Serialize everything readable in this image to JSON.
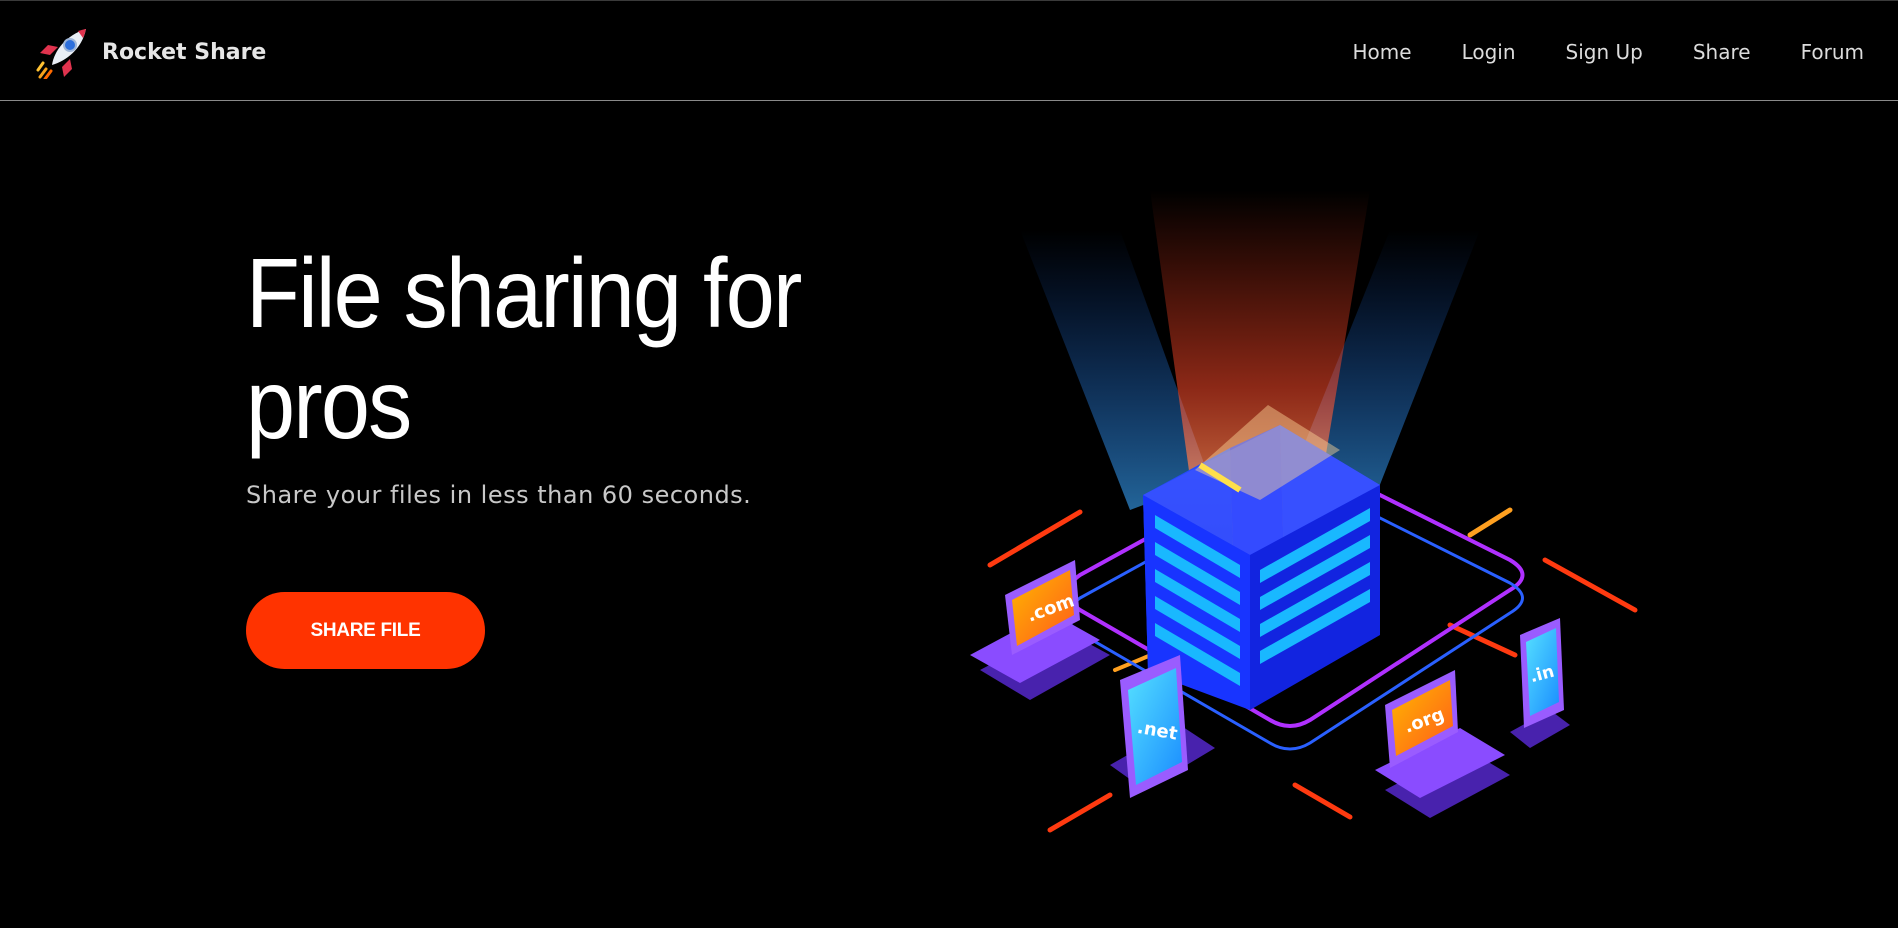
{
  "nav": {
    "brand": "Rocket Share",
    "links": [
      "Home",
      "Login",
      "Sign Up",
      "Share",
      "Forum"
    ]
  },
  "hero": {
    "title": "File sharing for pros",
    "subtitle": "Share your files in less than 60 seconds.",
    "cta": "SHARE FILE"
  },
  "illustration": {
    "labels": [
      ".com",
      ".net",
      ".org",
      ".in"
    ]
  },
  "colors": {
    "accent": "#ff3300",
    "server": "#1f3cff",
    "device": "#7b3cff"
  }
}
